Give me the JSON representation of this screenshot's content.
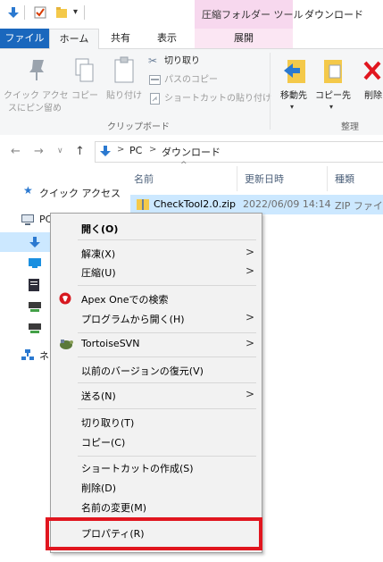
{
  "title_bar": {
    "contextual_tab_header": "圧縮フォルダー ツール",
    "window_title": "ダウンロード"
  },
  "ribbon_tabs": {
    "file": "ファイル",
    "home": "ホーム",
    "share": "共有",
    "view": "表示",
    "manage": "展開"
  },
  "ribbon": {
    "pin_quick_access": "クイック アクセス\nにピン留め",
    "pin_line1": "クイック アクセ",
    "pin_line2": "スにピン留め",
    "copy": "コピー",
    "paste": "貼り付け",
    "cut": "切り取り",
    "copy_path": "パスのコピー",
    "paste_shortcut": "ショートカットの貼り付け",
    "clipboard_group": "クリップボード",
    "move_to": "移動先",
    "copy_to": "コピー先",
    "delete": "削除",
    "organize_group": "整理"
  },
  "address_bar": {
    "segments": [
      "PC",
      "ダウンロード"
    ],
    "separator": ">"
  },
  "nav_pane": {
    "quick_access": "クイック アクセス",
    "pc": "PC",
    "network_prefix": "ネ"
  },
  "file_list": {
    "columns": [
      "名前",
      "更新日時",
      "種類"
    ],
    "rows": [
      {
        "name": "CheckTool2.0.zip",
        "modified": "2022/06/09 14:14",
        "type": "ZIP ファイル"
      }
    ]
  },
  "context_menu": {
    "items": [
      {
        "label": "開く(O)",
        "bold": true
      },
      {
        "label": "解凍(X)",
        "submenu": true
      },
      {
        "label": "圧縮(U)",
        "submenu": true
      },
      {
        "label": "Apex Oneでの検索"
      },
      {
        "label": "プログラムから開く(H)",
        "submenu": true
      },
      {
        "label": "TortoiseSVN",
        "submenu": true
      },
      {
        "label": "以前のバージョンの復元(V)"
      },
      {
        "label": "送る(N)",
        "submenu": true
      },
      {
        "label": "切り取り(T)"
      },
      {
        "label": "コピー(C)"
      },
      {
        "label": "ショートカットの作成(S)"
      },
      {
        "label": "削除(D)"
      },
      {
        "label": "名前の変更(M)"
      },
      {
        "label": "プロパティ(R)"
      }
    ],
    "submenu_arrow": ">"
  },
  "colors": {
    "file_tab": "#1a67bd",
    "selection": "#cce8ff",
    "highlight_box": "#e1161f",
    "contextual_tab": "#f7d8ee",
    "folder_yellow": "#f4c94a"
  }
}
